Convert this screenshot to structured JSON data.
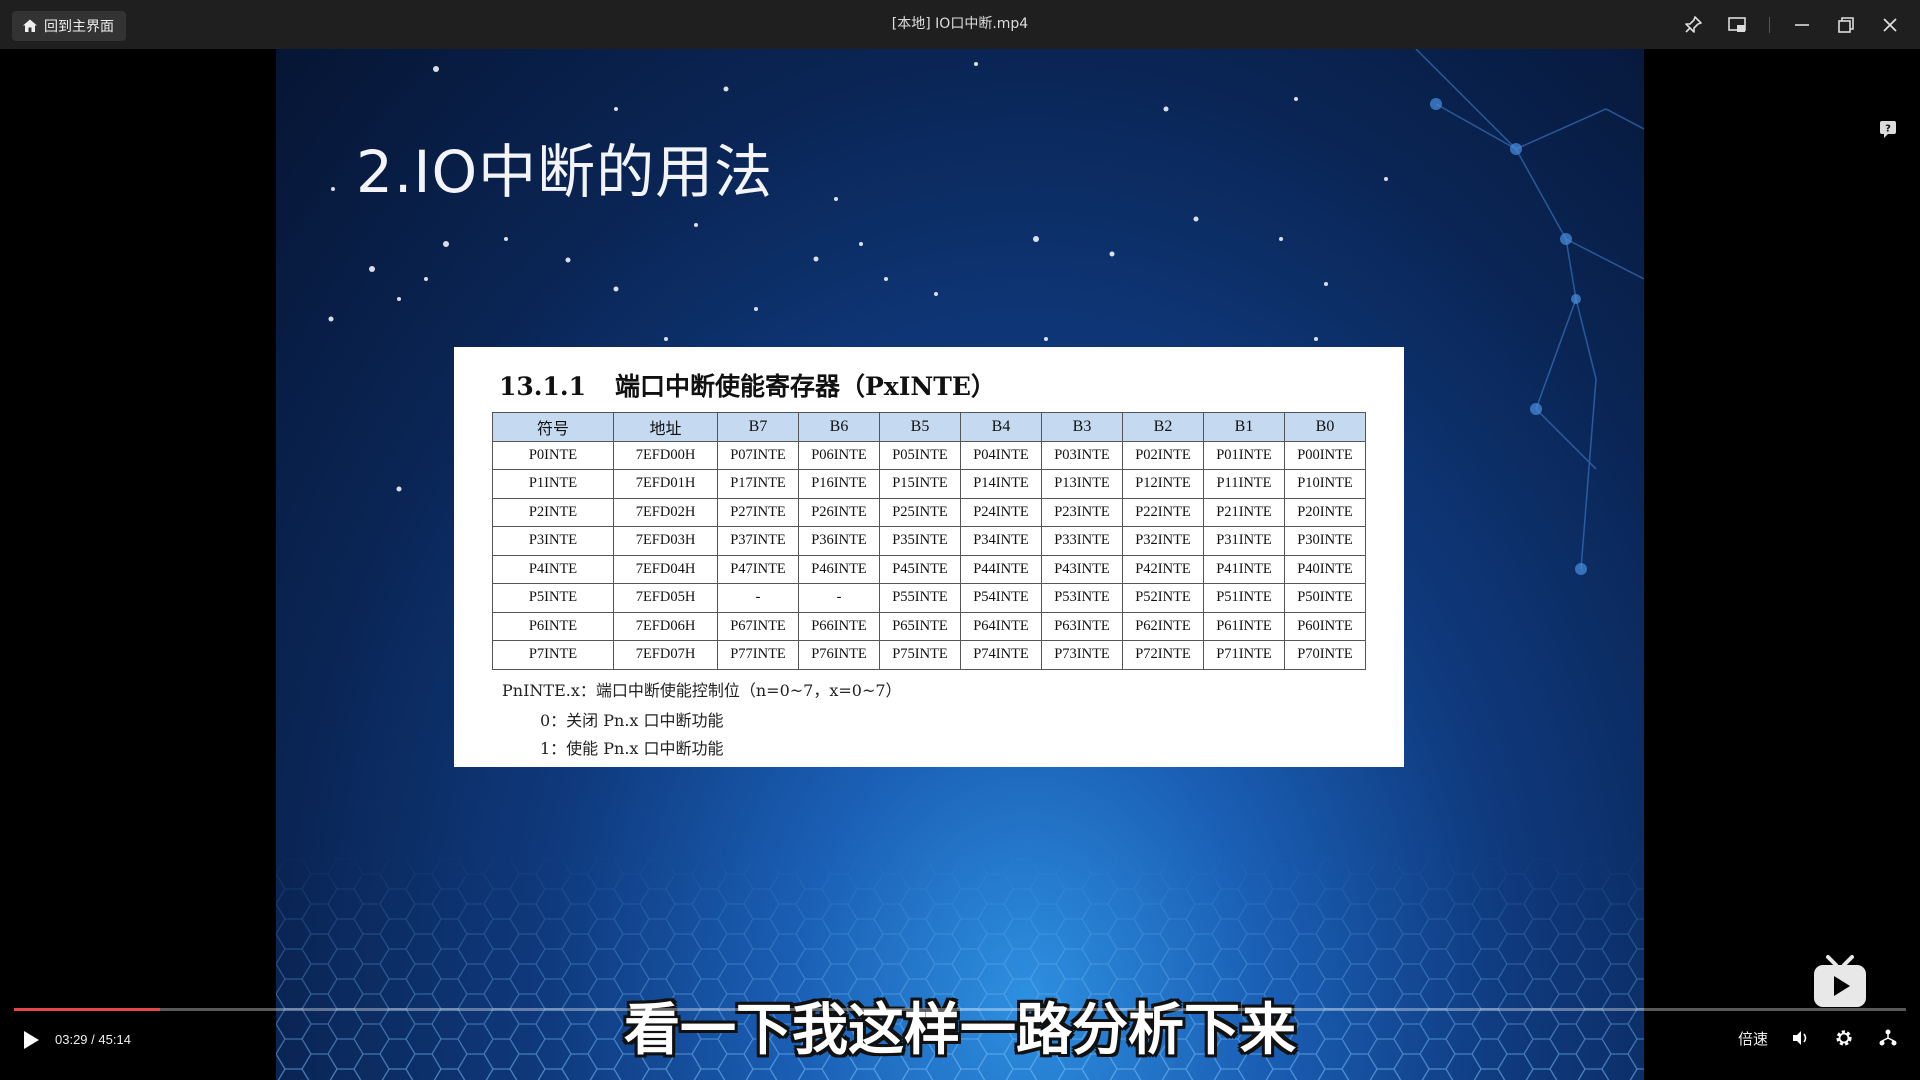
{
  "titlebar": {
    "home_label": "回到主界面",
    "title": "[本地] IO口中断.mp4",
    "icons": [
      "pin-icon",
      "picture-in-picture-icon",
      "minimize-icon",
      "restore-icon",
      "close-icon"
    ]
  },
  "slide": {
    "title": "2.IO中断的用法",
    "doc": {
      "section_number": "13.1.1",
      "section_title": "端口中断使能寄存器（PxINTE）",
      "headers": [
        "符号",
        "地址",
        "B7",
        "B6",
        "B5",
        "B4",
        "B3",
        "B2",
        "B1",
        "B0"
      ],
      "rows": [
        [
          "P0INTE",
          "7EFD00H",
          "P07INTE",
          "P06INTE",
          "P05INTE",
          "P04INTE",
          "P03INTE",
          "P02INTE",
          "P01INTE",
          "P00INTE"
        ],
        [
          "P1INTE",
          "7EFD01H",
          "P17INTE",
          "P16INTE",
          "P15INTE",
          "P14INTE",
          "P13INTE",
          "P12INTE",
          "P11INTE",
          "P10INTE"
        ],
        [
          "P2INTE",
          "7EFD02H",
          "P27INTE",
          "P26INTE",
          "P25INTE",
          "P24INTE",
          "P23INTE",
          "P22INTE",
          "P21INTE",
          "P20INTE"
        ],
        [
          "P3INTE",
          "7EFD03H",
          "P37INTE",
          "P36INTE",
          "P35INTE",
          "P34INTE",
          "P33INTE",
          "P32INTE",
          "P31INTE",
          "P30INTE"
        ],
        [
          "P4INTE",
          "7EFD04H",
          "P47INTE",
          "P46INTE",
          "P45INTE",
          "P44INTE",
          "P43INTE",
          "P42INTE",
          "P41INTE",
          "P40INTE"
        ],
        [
          "P5INTE",
          "7EFD05H",
          "-",
          "-",
          "P55INTE",
          "P54INTE",
          "P53INTE",
          "P52INTE",
          "P51INTE",
          "P50INTE"
        ],
        [
          "P6INTE",
          "7EFD06H",
          "P67INTE",
          "P66INTE",
          "P65INTE",
          "P64INTE",
          "P63INTE",
          "P62INTE",
          "P61INTE",
          "P60INTE"
        ],
        [
          "P7INTE",
          "7EFD07H",
          "P77INTE",
          "P76INTE",
          "P75INTE",
          "P74INTE",
          "P73INTE",
          "P72INTE",
          "P71INTE",
          "P70INTE"
        ]
      ],
      "note_main": "PnINTE.x：端口中断使能控制位（n=0~7，x=0~7）",
      "note_0": "0：关闭 Pn.x 口中断功能",
      "note_1": "1：使能 Pn.x 口中断功能"
    }
  },
  "subtitle": "看一下我这样一路分析下来",
  "player": {
    "current_time": "03:29",
    "separator": "/",
    "total_time": "45:14",
    "progress_fraction": 0.077,
    "speed_label": "倍速",
    "accent_color": "#e8454a"
  }
}
